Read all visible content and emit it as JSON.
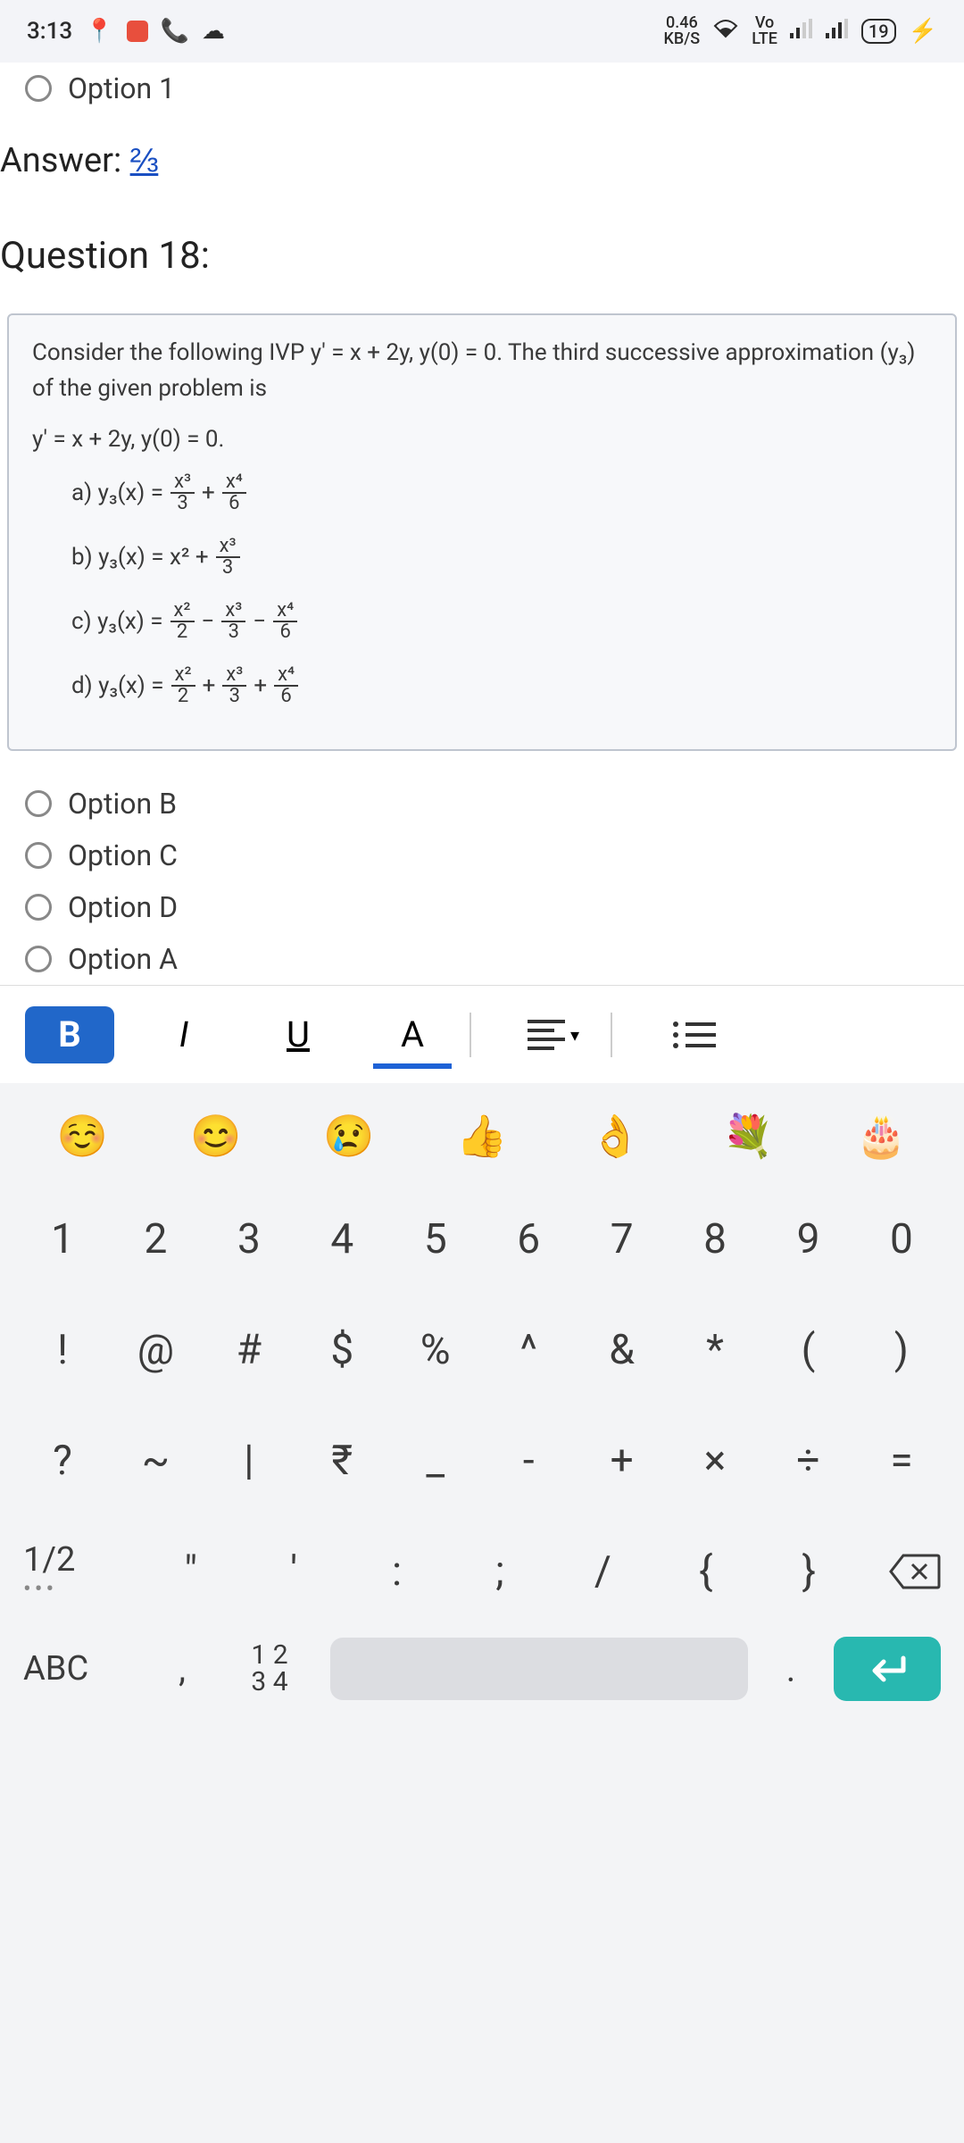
{
  "status": {
    "time": "3:13",
    "net_speed_top": "0.46",
    "net_speed_bottom": "KB/S",
    "vo_top": "Vo",
    "vo_bottom": "LTE",
    "battery": "19"
  },
  "document": {
    "option1_label": "Option 1",
    "answer_prefix": "Answer: ",
    "answer_value": "⅔",
    "question_title": "Question 18:",
    "problem_prompt": "Consider the following IVP  y′ = x + 2y,  y(0) = 0.  The third successive approximation (y₃) of the given problem is",
    "problem_eq": "y′ = x + 2y,  y(0) = 0.",
    "opts": {
      "a_label": "a)  y₃(x) =",
      "b_label": "b)  y₃(x) = x² +",
      "c_label": "c)  y₃(x) =",
      "d_label": "d)  y₃(x) ="
    },
    "radio_b": "Option B",
    "radio_c": "Option C",
    "radio_d": "Option D",
    "radio_a": "Option A"
  },
  "toolbar": {
    "bold": "B",
    "italic": "I",
    "underline": "U",
    "textcolor": "A"
  },
  "keyboard": {
    "emojis": [
      "☺️",
      "😊",
      "😢",
      "👍",
      "👌",
      "💐",
      "🎂"
    ],
    "row1": [
      "1",
      "2",
      "3",
      "4",
      "5",
      "6",
      "7",
      "8",
      "9",
      "0"
    ],
    "row2": [
      "!",
      "@",
      "#",
      "$",
      "%",
      "^",
      "&",
      "*",
      "(",
      ")"
    ],
    "row3": [
      "?",
      "~",
      "|",
      "₹",
      "_",
      "-",
      "+",
      "×",
      "÷",
      "="
    ],
    "row4_mode": "1/2",
    "row4_keys": [
      "\"",
      "'",
      ":",
      ";",
      "/",
      "{",
      "}"
    ],
    "abc": "ABC",
    "comma": ",",
    "numpad_top": "1 2",
    "numpad_bottom": "3 4",
    "period": "."
  }
}
